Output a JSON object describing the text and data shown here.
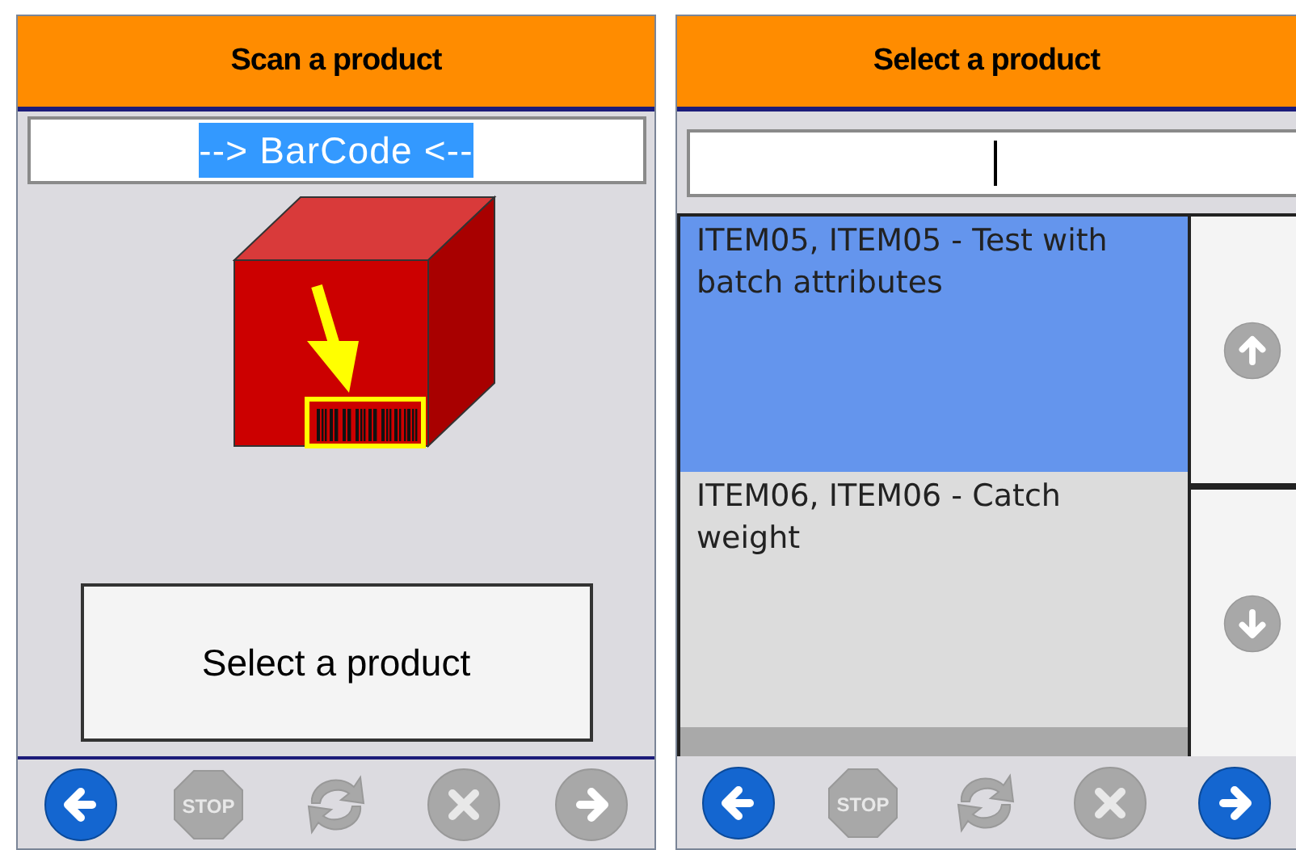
{
  "screens": [
    {
      "kind": "scan",
      "title": "Scan a product",
      "barcode_field": {
        "value": "--> BarCode <--",
        "text_selected": true
      },
      "action_button": "Select a product",
      "toolbar": [
        {
          "kind": "back",
          "disabled": false
        },
        {
          "kind": "stop",
          "label": "STOP",
          "disabled": true
        },
        {
          "kind": "refresh",
          "disabled": true
        },
        {
          "kind": "cancel",
          "disabled": true
        },
        {
          "kind": "forward",
          "disabled": true
        }
      ]
    },
    {
      "kind": "list",
      "title": "Select a product",
      "search_field": {
        "focused": true
      },
      "items": [
        {
          "text": "ITEM05, ITEM05 - Test with batch attributes",
          "selected": true
        },
        {
          "text": "ITEM06, ITEM06 - Catch weight",
          "selected": false
        }
      ],
      "scroll_buttons": [
        {
          "kind": "up",
          "disabled": true
        },
        {
          "kind": "down",
          "disabled": true
        }
      ],
      "toolbar": [
        {
          "kind": "back",
          "disabled": false
        },
        {
          "kind": "stop",
          "label": "STOP",
          "disabled": true
        },
        {
          "kind": "refresh",
          "disabled": true
        },
        {
          "kind": "cancel",
          "disabled": true
        },
        {
          "kind": "forward",
          "disabled": false
        }
      ]
    }
  ]
}
